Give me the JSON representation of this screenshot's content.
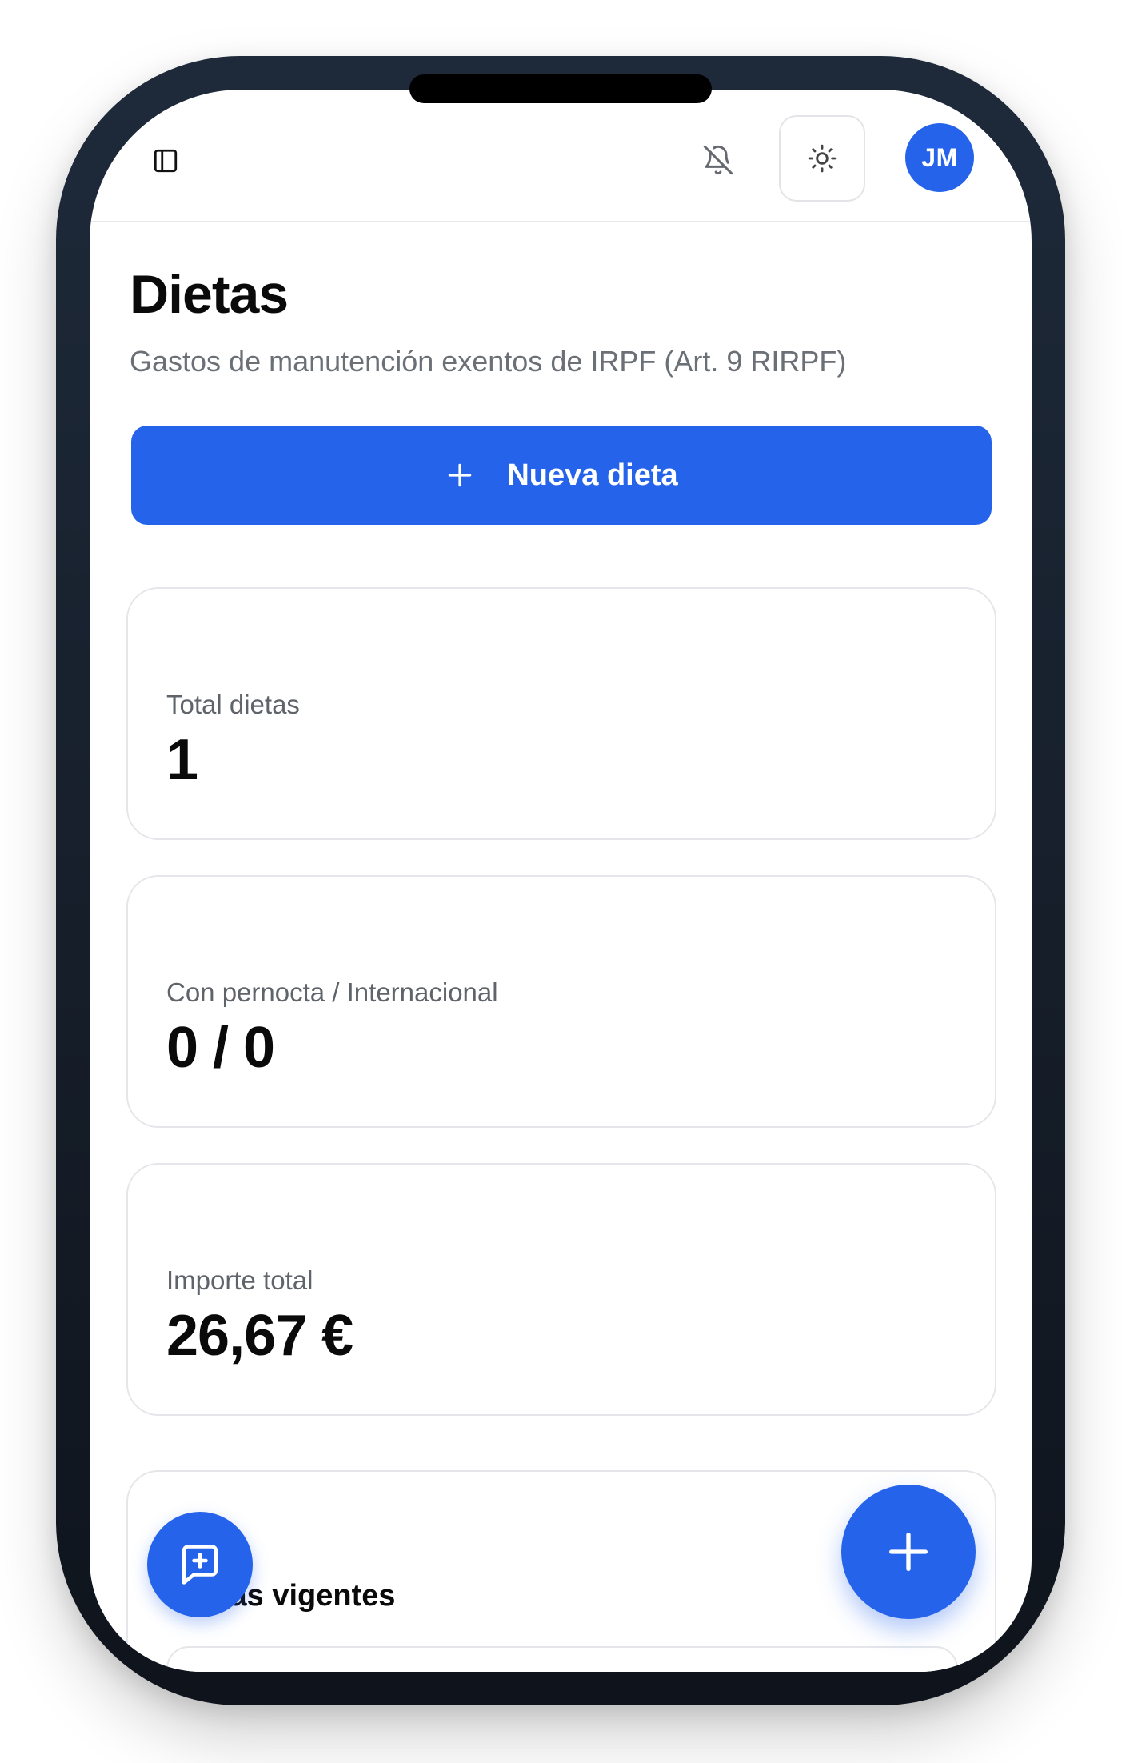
{
  "header": {
    "avatar_initials": "JM",
    "icons": [
      "sidebar-toggle-icon",
      "bell-off-icon",
      "sun-icon"
    ]
  },
  "page": {
    "title": "Dietas",
    "subtitle": "Gastos de manutención exentos de IRPF (Art. 9 RIRPF)"
  },
  "actions": {
    "new_label": "Nueva dieta"
  },
  "stats": [
    {
      "label": "Total dietas",
      "value": "1"
    },
    {
      "label": "Con pernocta / Internacional",
      "value": "0 / 0"
    },
    {
      "label": "Importe total",
      "value": "26,67 €"
    }
  ],
  "rates": {
    "title": "Tarifas vigentes"
  },
  "colors": {
    "accent": "#2563eb",
    "text": "#0a0a0a",
    "muted": "#6b6f76",
    "border": "#e4e6ea"
  }
}
